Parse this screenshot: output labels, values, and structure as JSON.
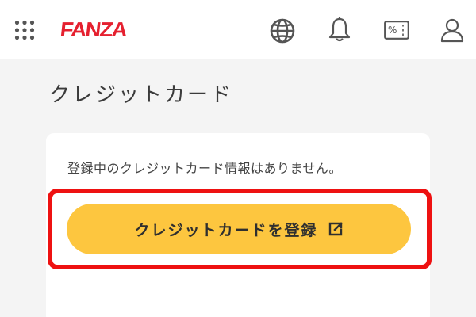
{
  "header": {
    "logo_text": "FANZA",
    "icons": [
      "grid-menu-icon",
      "globe-icon",
      "bell-icon",
      "coupon-icon",
      "user-icon"
    ],
    "coupon_symbol": "%"
  },
  "page": {
    "title": "クレジットカード"
  },
  "card": {
    "message": "登録中のクレジットカード情報はありません。",
    "register_button_label": "クレジットカードを登録",
    "register_button_icon": "external-link-icon"
  },
  "colors": {
    "brand": "#e5202f",
    "button": "#fdc63f",
    "highlight": "#ee1111",
    "background": "#f4f4f4"
  }
}
